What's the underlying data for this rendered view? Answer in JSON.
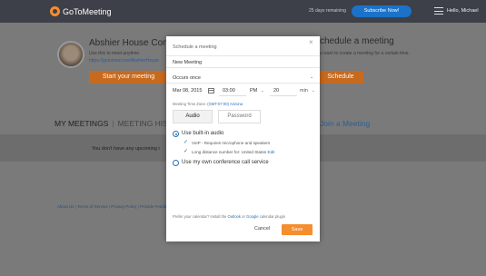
{
  "topbar": {
    "brand": "GoToMeeting",
    "days_remaining": "25 days remaining",
    "subscribe_label": "Subscribe Now!",
    "greeting": "Hello, Michael"
  },
  "profile": {
    "room_name": "Abshier House Confe",
    "subtitle": "Use this to meet anytime.",
    "link": "https://gotomeet.me/AbshierHouse",
    "start_label": "Start your meeting"
  },
  "schedule_panel": {
    "title": "chedule a meeting",
    "subtitle": "u want to create a meeting for a certain time.",
    "schedule_label": "Schedule"
  },
  "tabs": {
    "my_meetings": "MY MEETINGS",
    "separator": "|",
    "history": "MEETING HIST",
    "join": "Join a Meeting"
  },
  "empty_message": "You don't have any upcoming r",
  "footer": "About Us  |  Terms of Service  |  Privacy Policy  |  Provide Feedb",
  "modal": {
    "title": "Schedule a meeting",
    "close": "×",
    "meeting_name": "New Meeting",
    "occurs": "Occurs once",
    "date": "Mar 08, 2015",
    "time": "03:00",
    "ampm": "PM",
    "duration": "20",
    "duration_unit": "min",
    "timezone_prefix": "Meeting Time Zone:",
    "timezone": "(GMT-07:00) Arizona",
    "tab_audio": "Audio",
    "tab_password": "Password",
    "audio_builtin": "Use built-in audio",
    "voip": "VoIP - Requires microphone and speakers",
    "long_distance": "Long distance number for: United States",
    "edit": "Edit",
    "own_service": "Use my own conference call service",
    "prefer_text": "Prefer your calendar? Install the",
    "outlook": "Outlook",
    "or": "or",
    "google": "Google",
    "plugin": "calendar plugin",
    "cancel": "Cancel",
    "save": "Save"
  },
  "colors": {
    "accent_orange": "#f68d2e",
    "link_blue": "#2a6fb8",
    "topbar_bg": "#3d4048",
    "subscribe_blue": "#1b72c9"
  }
}
